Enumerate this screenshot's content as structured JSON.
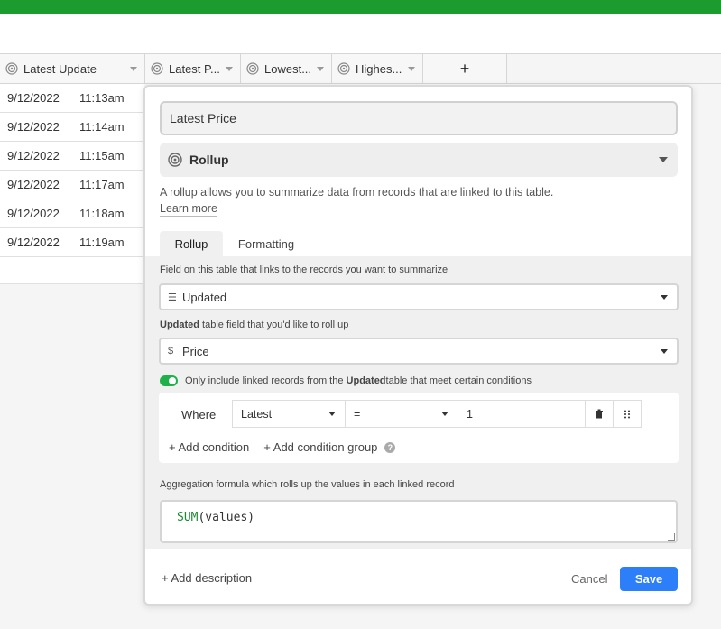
{
  "table": {
    "columns": [
      {
        "label": "Latest Update",
        "icon": "rollup-icon"
      },
      {
        "label": "Latest P...",
        "icon": "rollup-icon"
      },
      {
        "label": "Lowest...",
        "icon": "rollup-icon"
      },
      {
        "label": "Highes...",
        "icon": "rollup-icon"
      }
    ],
    "add_column_label": "+",
    "rows": [
      {
        "date": "9/12/2022",
        "time": "11:13am"
      },
      {
        "date": "9/12/2022",
        "time": "11:14am"
      },
      {
        "date": "9/12/2022",
        "time": "11:15am"
      },
      {
        "date": "9/12/2022",
        "time": "11:17am"
      },
      {
        "date": "9/12/2022",
        "time": "11:18am"
      },
      {
        "date": "9/12/2022",
        "time": "11:19am"
      }
    ]
  },
  "dialog": {
    "field_name": "Latest Price",
    "field_type": "Rollup",
    "description": "A rollup allows you to summarize data from records that are linked to this table.",
    "learn_more": "Learn more",
    "tabs": [
      "Rollup",
      "Formatting"
    ],
    "link_field_label": "Field on this table that links to the records you want to summarize",
    "link_field_value": "Updated",
    "rollup_field_label_bold": "Updated",
    "rollup_field_label_rest": " table field that you'd like to roll up",
    "rollup_field_value": "Price",
    "toggle_text_pre": "Only include linked records from the ",
    "toggle_text_bold": "Updated",
    "toggle_text_post": " table that meet certain conditions",
    "condition": {
      "where": "Where",
      "field": "Latest",
      "operator": "=",
      "value": "1"
    },
    "add_condition": "+  Add condition",
    "add_condition_group": "+  Add condition group",
    "help": "?",
    "aggregation_label": "Aggregation formula which rolls up the values in each linked record",
    "formula_fn": "SUM",
    "formula_args": "(values)",
    "add_description": "+ Add description",
    "cancel": "Cancel",
    "save": "Save"
  },
  "colors": {
    "accent": "#2d7ff9",
    "topbar": "#1c9b2e",
    "toggle_on": "#20b04b"
  }
}
